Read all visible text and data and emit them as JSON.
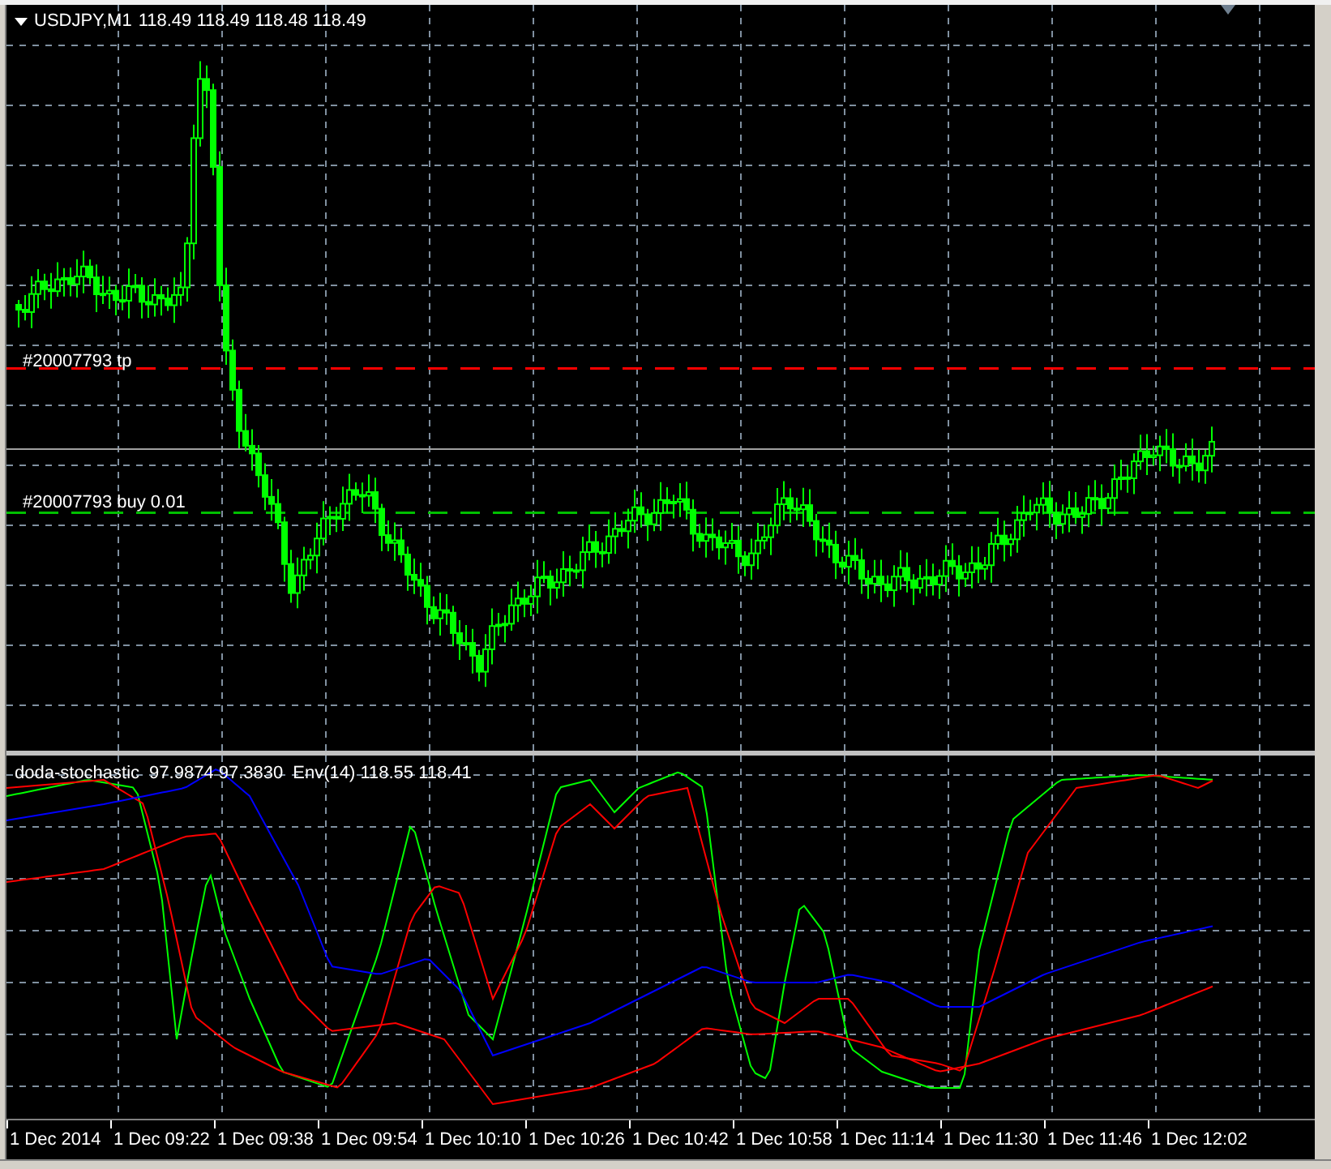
{
  "chart": {
    "title": "USDJPY,M1",
    "quotes": "118.49 118.49 118.48 118.49"
  },
  "order_lines": [
    {
      "label": "#20007793 tp",
      "kind": "tp",
      "color": "#ff0000"
    },
    {
      "label": "#20007793 buy 0.01",
      "kind": "buy",
      "color": "#00c000"
    }
  ],
  "indicator": {
    "name": "doda-stochastic",
    "values": "97.9874 97.3830",
    "envelope": "Env(14) 118.55 118.41"
  },
  "time_axis": [
    "1 Dec 2014",
    "1 Dec 09:22",
    "1 Dec 09:38",
    "1 Dec 09:54",
    "1 Dec 10:10",
    "1 Dec 10:26",
    "1 Dec 10:42",
    "1 Dec 10:58",
    "1 Dec 11:14",
    "1 Dec 11:30",
    "1 Dec 11:46",
    "1 Dec 12:02"
  ]
}
